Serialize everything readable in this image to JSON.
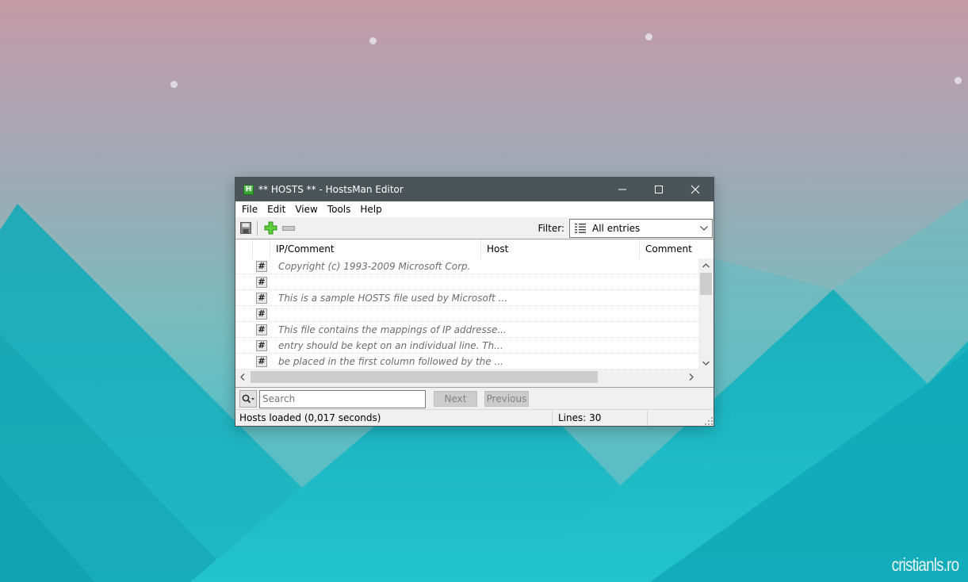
{
  "desktop": {
    "watermark": "cristianls.ro"
  },
  "window": {
    "title": "** HOSTS ** - HostsMan Editor",
    "app_icon_letter": "H",
    "controls": {
      "minimize": "minimize-icon",
      "maximize": "maximize-icon",
      "close": "close-icon"
    }
  },
  "menu": {
    "items": [
      "File",
      "Edit",
      "View",
      "Tools",
      "Help"
    ]
  },
  "toolbar": {
    "save": "save-icon",
    "add": "add-icon",
    "remove": "remove-icon",
    "filter_label": "Filter:",
    "filter_value": "All entries"
  },
  "grid": {
    "columns": [
      "IP/Comment",
      "Host",
      "Comment"
    ],
    "row_marker": "#",
    "rows": [
      {
        "type": "comment",
        "text": "Copyright (c) 1993-2009 Microsoft Corp."
      },
      {
        "type": "comment",
        "text": ""
      },
      {
        "type": "comment",
        "text": "This is a sample HOSTS file used by Microsoft ..."
      },
      {
        "type": "comment",
        "text": ""
      },
      {
        "type": "comment",
        "text": "This file contains the mappings of IP addresse..."
      },
      {
        "type": "comment",
        "text": "entry should be kept on an individual line. Th..."
      },
      {
        "type": "comment",
        "text": "be placed in the first column followed by the ..."
      }
    ]
  },
  "search": {
    "placeholder": "Search",
    "value": "",
    "next_label": "Next",
    "previous_label": "Previous"
  },
  "status": {
    "message": "Hosts loaded (0,017 seconds)",
    "lines": "Lines: 30"
  },
  "colors": {
    "titlebar": "#4b5559",
    "accent_green": "#3fae2a"
  }
}
